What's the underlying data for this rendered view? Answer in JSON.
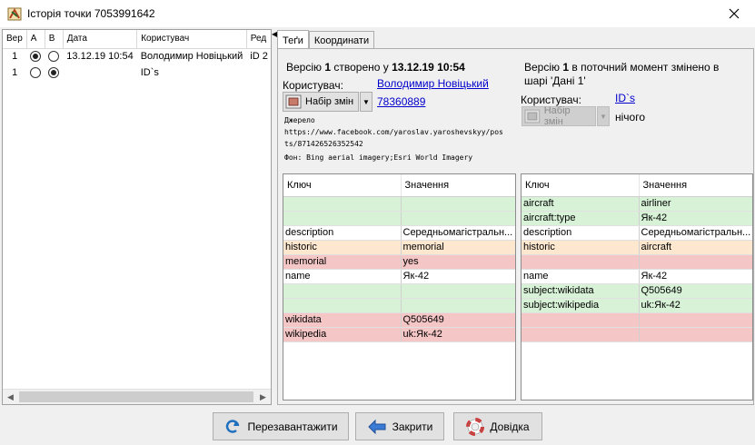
{
  "window": {
    "title": "Історія точки 7053991642"
  },
  "history": {
    "columns": [
      "Вер",
      "A",
      "B",
      "Дата",
      "Користувач",
      "Ред"
    ],
    "rows": [
      {
        "ver": "1",
        "a_selected": true,
        "b_selected": false,
        "date": "13.12.19 10:54",
        "user": "Володимир Новіцький",
        "editor": "iD 2"
      },
      {
        "ver": "1",
        "a_selected": false,
        "b_selected": true,
        "date": "",
        "user": "ID`s",
        "editor": ""
      }
    ]
  },
  "tabs": [
    {
      "label": "Теґи",
      "active": true
    },
    {
      "label": "Координати",
      "active": false
    }
  ],
  "left_version": {
    "prefix": "Версію ",
    "num": "1",
    "middle": " створено у ",
    "date": "13.12.19 10:54",
    "user_label": "Користувач:",
    "user_link": "Володимир Новіцький",
    "changeset_button": "Набір змін",
    "changeset_link": "78360889",
    "source_label": "Джерело",
    "source_line1": "https://www.facebook.com/yaroslav.yaroshevskyy/pos",
    "source_line2": "ts/871426526352542",
    "imagery": "Фон: Bing aerial imagery;Esri World Imagery"
  },
  "right_version": {
    "prefix": "Версію ",
    "num": "1",
    "suffix": " в поточний момент змінено в",
    "line2": "шарі 'Дані 1'",
    "user_label": "Користувач:",
    "user_link": "ID`s",
    "changeset_button": "Набір змін",
    "changeset_value": "нічого"
  },
  "tag_headers": {
    "key": "Ключ",
    "value": "Значення"
  },
  "left_tags": [
    {
      "key": "",
      "value": "",
      "state": "added"
    },
    {
      "key": "",
      "value": "",
      "state": "added"
    },
    {
      "key": "description",
      "value": "Середньомагістральн...",
      "state": "same"
    },
    {
      "key": "historic",
      "value": "memorial",
      "state": "changed"
    },
    {
      "key": "memorial",
      "value": "yes",
      "state": "removed"
    },
    {
      "key": "name",
      "value": "Як-42",
      "state": "same"
    },
    {
      "key": "",
      "value": "",
      "state": "added"
    },
    {
      "key": "",
      "value": "",
      "state": "added"
    },
    {
      "key": "wikidata",
      "value": "Q505649",
      "state": "removed"
    },
    {
      "key": "wikipedia",
      "value": "uk:Як-42",
      "state": "removed"
    }
  ],
  "right_tags": [
    {
      "key": "aircraft",
      "value": "airliner",
      "state": "added"
    },
    {
      "key": "aircraft:type",
      "value": "Як-42",
      "state": "added"
    },
    {
      "key": "description",
      "value": "Середньомагістральн...",
      "state": "same"
    },
    {
      "key": "historic",
      "value": "aircraft",
      "state": "changed"
    },
    {
      "key": "",
      "value": "",
      "state": "removed"
    },
    {
      "key": "name",
      "value": "Як-42",
      "state": "same"
    },
    {
      "key": "subject:wikidata",
      "value": "Q505649",
      "state": "added"
    },
    {
      "key": "subject:wikipedia",
      "value": "uk:Як-42",
      "state": "added"
    },
    {
      "key": "",
      "value": "",
      "state": "removed"
    },
    {
      "key": "",
      "value": "",
      "state": "removed"
    }
  ],
  "state_colors": {
    "added": "#d7f2d7",
    "removed": "#f5c6c6",
    "changed": "#fde8cf",
    "same": "#ffffff"
  },
  "buttons": {
    "reload": "Перезавантажити",
    "close": "Закрити",
    "help": "Довідка"
  },
  "icons": {
    "app": "history-icon",
    "close": "close-icon",
    "changeset": "changeset-icon",
    "reload": "reload-icon",
    "close_btn": "arrow-back-icon",
    "help": "lifebuoy-icon"
  }
}
